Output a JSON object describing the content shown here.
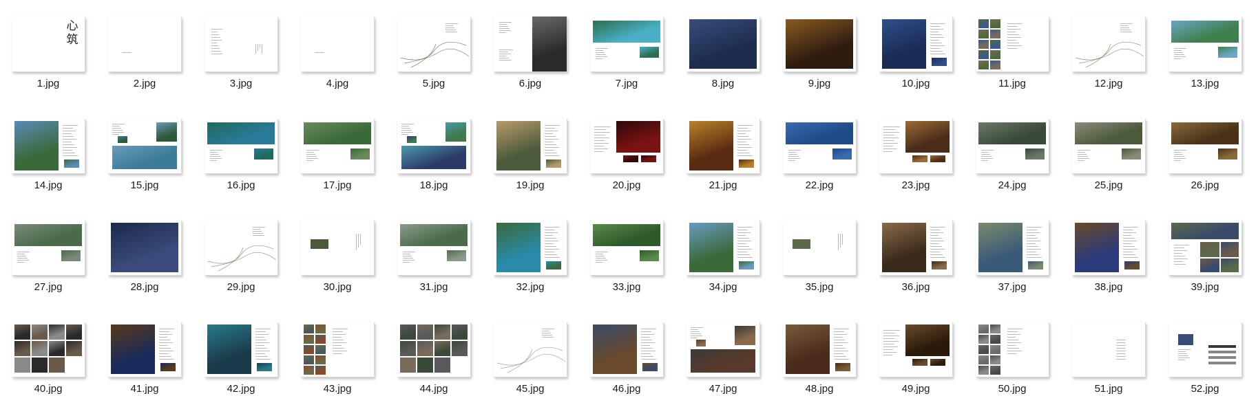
{
  "files": [
    {
      "name": "1.jpg",
      "layout": "callig",
      "callig": "心筑"
    },
    {
      "name": "2.jpg",
      "layout": "blank"
    },
    {
      "name": "3.jpg",
      "layout": "text-left"
    },
    {
      "name": "4.jpg",
      "layout": "blank"
    },
    {
      "name": "5.jpg",
      "layout": "curve",
      "colors": [
        "#8a7a6a"
      ]
    },
    {
      "name": "6.jpg",
      "layout": "portrait",
      "colors": [
        "#2a2a2a",
        "#6b6a6a"
      ]
    },
    {
      "name": "7.jpg",
      "layout": "banner",
      "colors": [
        "#49b0c8",
        "#2e6e4f"
      ]
    },
    {
      "name": "8.jpg",
      "layout": "full-right",
      "colors": [
        "#1b2c4e",
        "#3a4d7a"
      ]
    },
    {
      "name": "9.jpg",
      "layout": "full",
      "colors": [
        "#2e1c10",
        "#8a5a22"
      ]
    },
    {
      "name": "10.jpg",
      "layout": "half-left",
      "colors": [
        "#1a2b55",
        "#2f4f8a"
      ]
    },
    {
      "name": "11.jpg",
      "layout": "grid-left",
      "colors": [
        "#3c5a8a",
        "#4c6b3a",
        "#7a6a5a"
      ]
    },
    {
      "name": "12.jpg",
      "layout": "curve",
      "colors": [
        "#9a8a7a"
      ]
    },
    {
      "name": "13.jpg",
      "layout": "banner",
      "colors": [
        "#3f7f4a",
        "#6aa6c6"
      ]
    },
    {
      "name": "14.jpg",
      "layout": "half-left",
      "colors": [
        "#3b6a3a",
        "#5a8ab8"
      ]
    },
    {
      "name": "15.jpg",
      "layout": "collage",
      "colors": [
        "#3c7a9a",
        "#2e5a3a",
        "#6a9aba"
      ]
    },
    {
      "name": "16.jpg",
      "layout": "banner",
      "colors": [
        "#2a7a9a",
        "#1f6a5a"
      ]
    },
    {
      "name": "17.jpg",
      "layout": "banner",
      "colors": [
        "#3a6a3a",
        "#6a8a5a"
      ]
    },
    {
      "name": "18.jpg",
      "layout": "collage",
      "colors": [
        "#2c3a6a",
        "#3f7a4a",
        "#4a9aaa"
      ]
    },
    {
      "name": "19.jpg",
      "layout": "half-left",
      "colors": [
        "#4a5a3a",
        "#b89a6a"
      ]
    },
    {
      "name": "20.jpg",
      "layout": "half-right",
      "colors": [
        "#7a1212",
        "#2a0a0a"
      ]
    },
    {
      "name": "21.jpg",
      "layout": "half-left",
      "colors": [
        "#5a2a12",
        "#b8822a"
      ]
    },
    {
      "name": "22.jpg",
      "layout": "banner",
      "colors": [
        "#1e4a86",
        "#3a6ab0"
      ]
    },
    {
      "name": "23.jpg",
      "layout": "half-right",
      "colors": [
        "#4a2c18",
        "#9a6a3a"
      ]
    },
    {
      "name": "24.jpg",
      "layout": "banner",
      "colors": [
        "#3a4a3a",
        "#6a7a6a"
      ]
    },
    {
      "name": "25.jpg",
      "layout": "banner",
      "colors": [
        "#4a5a3a",
        "#8a8a7a"
      ]
    },
    {
      "name": "26.jpg",
      "layout": "banner",
      "colors": [
        "#4a3218",
        "#8a6a3a"
      ]
    },
    {
      "name": "27.jpg",
      "layout": "banner",
      "colors": [
        "#4a6a4a",
        "#7a8a7a"
      ]
    },
    {
      "name": "28.jpg",
      "layout": "full",
      "colors": [
        "#3a4a7a",
        "#1a2a4a"
      ]
    },
    {
      "name": "29.jpg",
      "layout": "curve",
      "colors": [
        "#a09080"
      ]
    },
    {
      "name": "30.jpg",
      "layout": "small",
      "colors": [
        "#4a5a3a"
      ]
    },
    {
      "name": "31.jpg",
      "layout": "banner",
      "colors": [
        "#4a6a4a",
        "#8a9a8a"
      ]
    },
    {
      "name": "32.jpg",
      "layout": "half-left",
      "colors": [
        "#2a8aaa",
        "#3a6a3a"
      ]
    },
    {
      "name": "33.jpg",
      "layout": "banner",
      "colors": [
        "#2e5a2a",
        "#5a8a4a"
      ]
    },
    {
      "name": "34.jpg",
      "layout": "half-left",
      "colors": [
        "#3a6a3a",
        "#6a9ac0"
      ]
    },
    {
      "name": "35.jpg",
      "layout": "small",
      "colors": [
        "#5a6a4a"
      ]
    },
    {
      "name": "36.jpg",
      "layout": "half-left",
      "colors": [
        "#3a2a1a",
        "#8a6a4a"
      ]
    },
    {
      "name": "37.jpg",
      "layout": "half-left",
      "colors": [
        "#3a5a7a",
        "#7a8a6a"
      ]
    },
    {
      "name": "38.jpg",
      "layout": "half-left",
      "colors": [
        "#2a3a7a",
        "#6a4a2a"
      ]
    },
    {
      "name": "39.jpg",
      "layout": "grid-right",
      "colors": [
        "#3a4a6a",
        "#5a6a4a",
        "#6a5a4a"
      ]
    },
    {
      "name": "40.jpg",
      "layout": "grid-full",
      "colors": [
        "#2a2a2a",
        "#6a5a4a",
        "#8a8a8a"
      ]
    },
    {
      "name": "41.jpg",
      "layout": "half-left",
      "colors": [
        "#1a2a5a",
        "#5a3a1a"
      ]
    },
    {
      "name": "42.jpg",
      "layout": "half-left",
      "colors": [
        "#1a3a4a",
        "#2a7a8a"
      ]
    },
    {
      "name": "43.jpg",
      "layout": "grid-left",
      "colors": [
        "#4a5a5a",
        "#6a6a4a",
        "#8a4a2a"
      ]
    },
    {
      "name": "44.jpg",
      "layout": "grid-full",
      "colors": [
        "#3a4a3a",
        "#5a5a5a",
        "#7a6a5a"
      ]
    },
    {
      "name": "45.jpg",
      "layout": "curve",
      "colors": [
        "#b0a090"
      ]
    },
    {
      "name": "46.jpg",
      "layout": "half-left",
      "colors": [
        "#6a4a2a",
        "#3a4a6a"
      ]
    },
    {
      "name": "47.jpg",
      "layout": "collage",
      "colors": [
        "#5a3a2a",
        "#8a6a4a",
        "#3a3a3a"
      ]
    },
    {
      "name": "48.jpg",
      "layout": "half-left",
      "colors": [
        "#4a2a1a",
        "#7a5a3a"
      ]
    },
    {
      "name": "49.jpg",
      "layout": "half-right",
      "colors": [
        "#2a1a0a",
        "#6a4a2a"
      ]
    },
    {
      "name": "50.jpg",
      "layout": "grid-left",
      "colors": [
        "#6a6a6a",
        "#8a8a8a",
        "#4a4a4a"
      ]
    },
    {
      "name": "51.jpg",
      "layout": "text-center"
    },
    {
      "name": "52.jpg",
      "layout": "logos",
      "colors": [
        "#3a4a7a",
        "#222222"
      ]
    }
  ]
}
